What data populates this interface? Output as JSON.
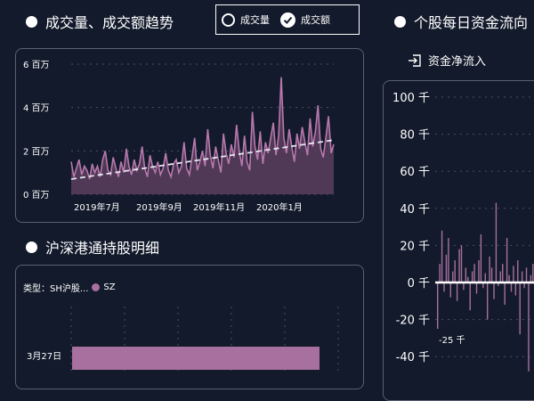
{
  "volume_section": {
    "title": "成交量、成交额趋势",
    "toggle": {
      "volume_label": "成交量",
      "turnover_label": "成交额",
      "selected": "成交额"
    }
  },
  "fund_section": {
    "title": "个股每日资金流向",
    "tab_label": "资金净流入"
  },
  "hk_section": {
    "title": "沪深港通持股明细",
    "type_label": "类型：SH沪股...",
    "legend_item": "SZ"
  },
  "colors": {
    "bar": "#a7709e",
    "area_line": "#b878ae",
    "area_fill": "#5a3f5e",
    "trend": "#e8e8f0",
    "bg": "#121a2b"
  },
  "chart_data": [
    {
      "type": "area",
      "y_tick_labels": [
        "0 百万",
        "2 百万",
        "4 百万",
        "6 百万"
      ],
      "x_tick_labels": [
        "2019年7月",
        "2019年9月",
        "2019年11月",
        "2020年1月"
      ],
      "ylim": [
        0,
        6
      ],
      "trend_line": [
        0.7,
        2.5
      ],
      "series": [
        {
          "values": [
            1.5,
            0.8,
            1.2,
            1.6,
            0.9,
            1.3,
            1.1,
            0.7,
            1.4,
            1.0,
            1.3,
            0.8,
            1.6,
            2.0,
            1.1,
            0.9,
            1.7,
            1.2,
            0.8,
            1.5,
            1.0,
            2.1,
            1.3,
            0.9,
            1.6,
            1.1,
            1.4,
            2.2,
            1.2,
            0.8,
            1.8,
            1.3,
            1.0,
            1.5,
            0.9,
            1.2,
            1.9,
            1.1,
            0.8,
            1.4,
            1.6,
            1.0,
            1.3,
            2.4,
            1.2,
            0.9,
            1.7,
            2.6,
            1.1,
            1.5,
            2.0,
            1.3,
            3.0,
            1.8,
            1.2,
            2.2,
            1.6,
            1.0,
            2.8,
            1.9,
            1.4,
            2.3,
            1.7,
            3.2,
            2.0,
            1.3,
            2.7,
            1.5,
            1.1,
            3.8,
            2.2,
            1.6,
            2.9,
            1.4,
            2.4,
            1.9,
            2.6,
            3.3,
            1.8,
            2.7,
            5.4,
            2.6,
            1.9,
            3.0,
            2.2,
            1.5,
            2.8,
            2.1,
            3.1,
            2.4,
            1.8,
            3.5,
            2.2,
            2.9,
            4.1,
            2.1,
            1.7,
            2.6,
            3.6,
            1.9,
            2.3
          ]
        }
      ]
    },
    {
      "type": "bar",
      "y_tick_labels": [
        "-40 千",
        "-20 千",
        "0 千",
        "20 千",
        "40 千",
        "60 千",
        "80 千",
        "100 千"
      ],
      "ylim": [
        -45,
        105
      ],
      "annotation": "-25 千",
      "series": [
        {
          "values": [
            -25,
            10,
            28,
            -5,
            15,
            24,
            -8,
            6,
            12,
            -10,
            18,
            20,
            -4,
            8,
            3,
            -15,
            6,
            10,
            -6,
            12,
            26,
            -3,
            5,
            -20,
            14,
            8,
            -9,
            43,
            -2,
            6,
            10,
            -12,
            24,
            4,
            -5,
            9,
            -7,
            12,
            -28,
            6,
            -3,
            8,
            -48,
            4,
            10,
            -6
          ]
        }
      ]
    },
    {
      "type": "bar",
      "orientation": "horizontal",
      "categories": [
        "3月27日"
      ],
      "series": [
        {
          "name": "SZ",
          "values": [
            1
          ]
        }
      ]
    }
  ]
}
